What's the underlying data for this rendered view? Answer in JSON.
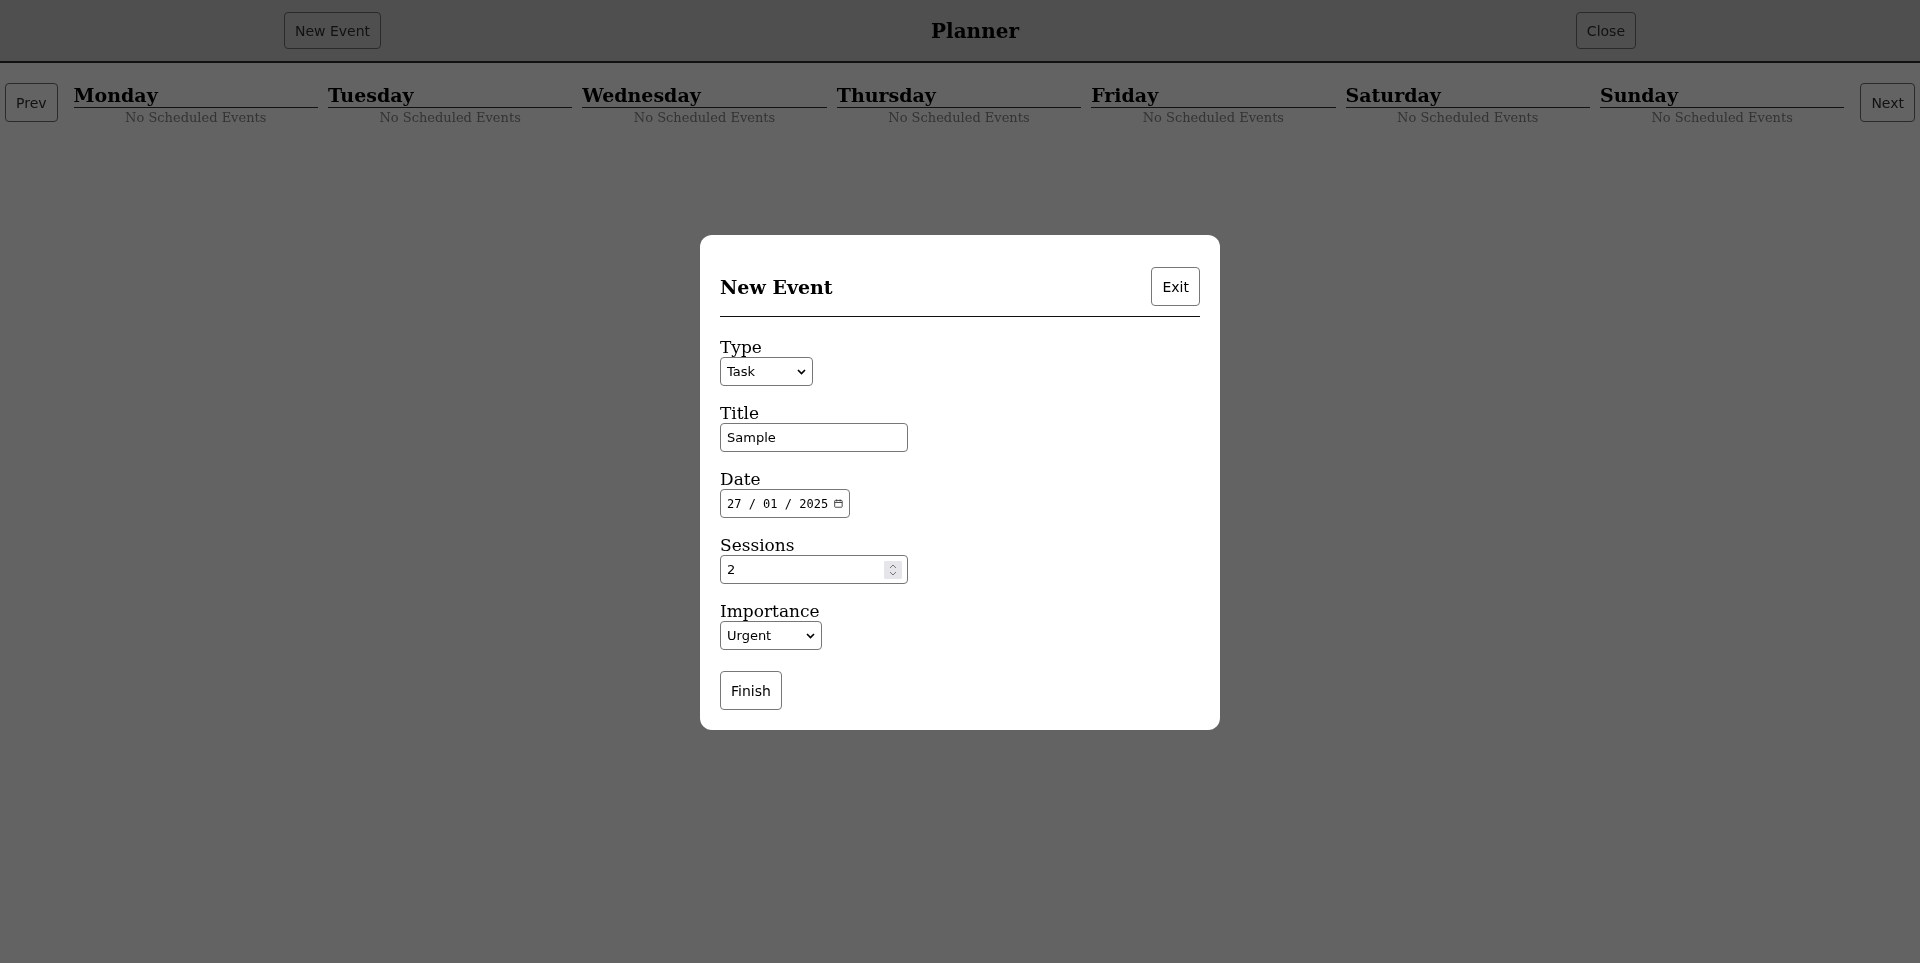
{
  "header": {
    "new_event_button": "New Event",
    "title": "Planner",
    "close_button": "Close"
  },
  "week": {
    "prev_button": "Prev",
    "next_button": "Next",
    "days": [
      {
        "name": "Monday",
        "empty_text": "No Scheduled Events"
      },
      {
        "name": "Tuesday",
        "empty_text": "No Scheduled Events"
      },
      {
        "name": "Wednesday",
        "empty_text": "No Scheduled Events"
      },
      {
        "name": "Thursday",
        "empty_text": "No Scheduled Events"
      },
      {
        "name": "Friday",
        "empty_text": "No Scheduled Events"
      },
      {
        "name": "Saturday",
        "empty_text": "No Scheduled Events"
      },
      {
        "name": "Sunday",
        "empty_text": "No Scheduled Events"
      }
    ]
  },
  "dialog": {
    "title": "New Event",
    "exit_button": "Exit",
    "fields": [
      {
        "kind": "select",
        "label": "Type",
        "value": "Task"
      },
      {
        "kind": "text",
        "label": "Title",
        "value": "Sample"
      },
      {
        "kind": "date",
        "label": "Date",
        "value": "27 / 01 / 2025"
      },
      {
        "kind": "number",
        "label": "Sessions",
        "value": "2"
      },
      {
        "kind": "select",
        "label": "Importance",
        "value": "Urgent"
      }
    ],
    "submit_button": "Finish"
  }
}
